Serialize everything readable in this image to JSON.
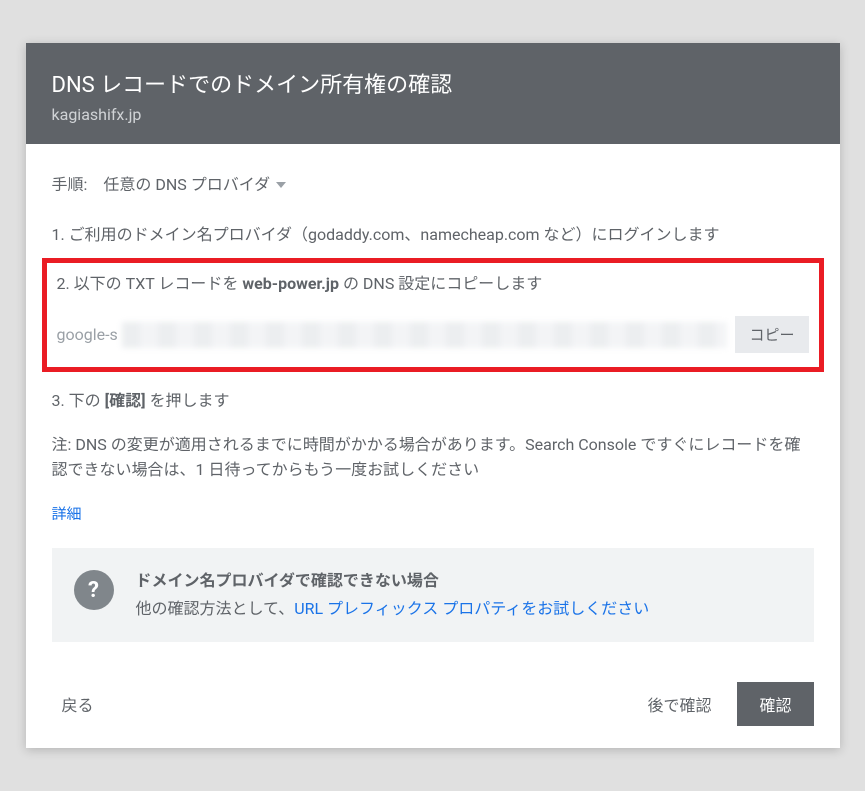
{
  "header": {
    "title": "DNS レコードでのドメイン所有権の確認",
    "subtitle": "kagiashifx.jp"
  },
  "steps": {
    "label": "手順:",
    "provider": "任意の DNS プロバイダ"
  },
  "step1": {
    "prefix": "1. ご利用のドメイン名プロバイダ（godaddy.com、namecheap.com など）にログインします"
  },
  "step2": {
    "prefix": "2. 以下の TXT レコードを ",
    "domain": "web-power.jp",
    "suffix": " の DNS 設定にコピーします"
  },
  "txt": {
    "prefix": "google-s",
    "copy_label": "コピー"
  },
  "step3": {
    "prefix": "3. 下の ",
    "bold": "[確認]",
    "suffix": " を押します"
  },
  "note": "注: DNS の変更が適用されるまでに時間がかかる場合があります。Search Console ですぐにレコードを確認できない場合は、1 日待ってからもう一度お試しください",
  "details_link": "詳細",
  "alt": {
    "title": "ドメイン名プロバイダで確認できない場合",
    "text_prefix": "他の確認方法として、",
    "link": "URL プレフィックス プロパティをお試しください"
  },
  "footer": {
    "back": "戻る",
    "later": "後で確認",
    "confirm": "確認"
  }
}
